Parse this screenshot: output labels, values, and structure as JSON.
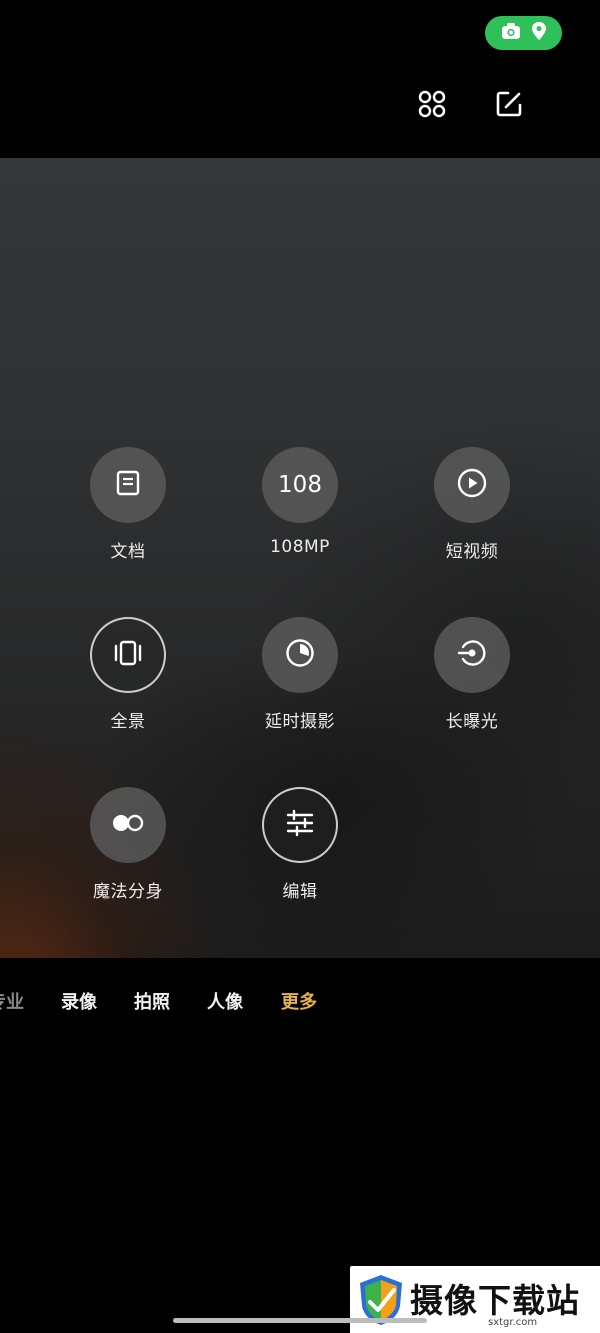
{
  "status": {
    "pill_color": "#2fc05a",
    "icons": [
      "camera-icon",
      "location-pin-icon"
    ]
  },
  "top_bar": {
    "icons": [
      "grid-layout-icon",
      "edit-icon"
    ]
  },
  "modes": [
    {
      "label": "文档",
      "icon": "document-icon"
    },
    {
      "label": "108MP",
      "icon_text": "108"
    },
    {
      "label": "短视频",
      "icon": "play-icon"
    },
    {
      "label": "全景",
      "icon": "panorama-icon"
    },
    {
      "label": "延时摄影",
      "icon": "timelapse-icon"
    },
    {
      "label": "长曝光",
      "icon": "long-exposure-icon"
    },
    {
      "label": "魔法分身",
      "icon": "clone-icon"
    },
    {
      "label": "编辑",
      "icon": "sliders-icon"
    }
  ],
  "tabs": {
    "partial": "专业",
    "video": "录像",
    "photo": "拍照",
    "portrait": "人像",
    "more": "更多"
  },
  "colors": {
    "active_tab": "#e6b34a"
  },
  "watermark": {
    "text": "摄像下载站",
    "url": "sxtgr.com"
  }
}
